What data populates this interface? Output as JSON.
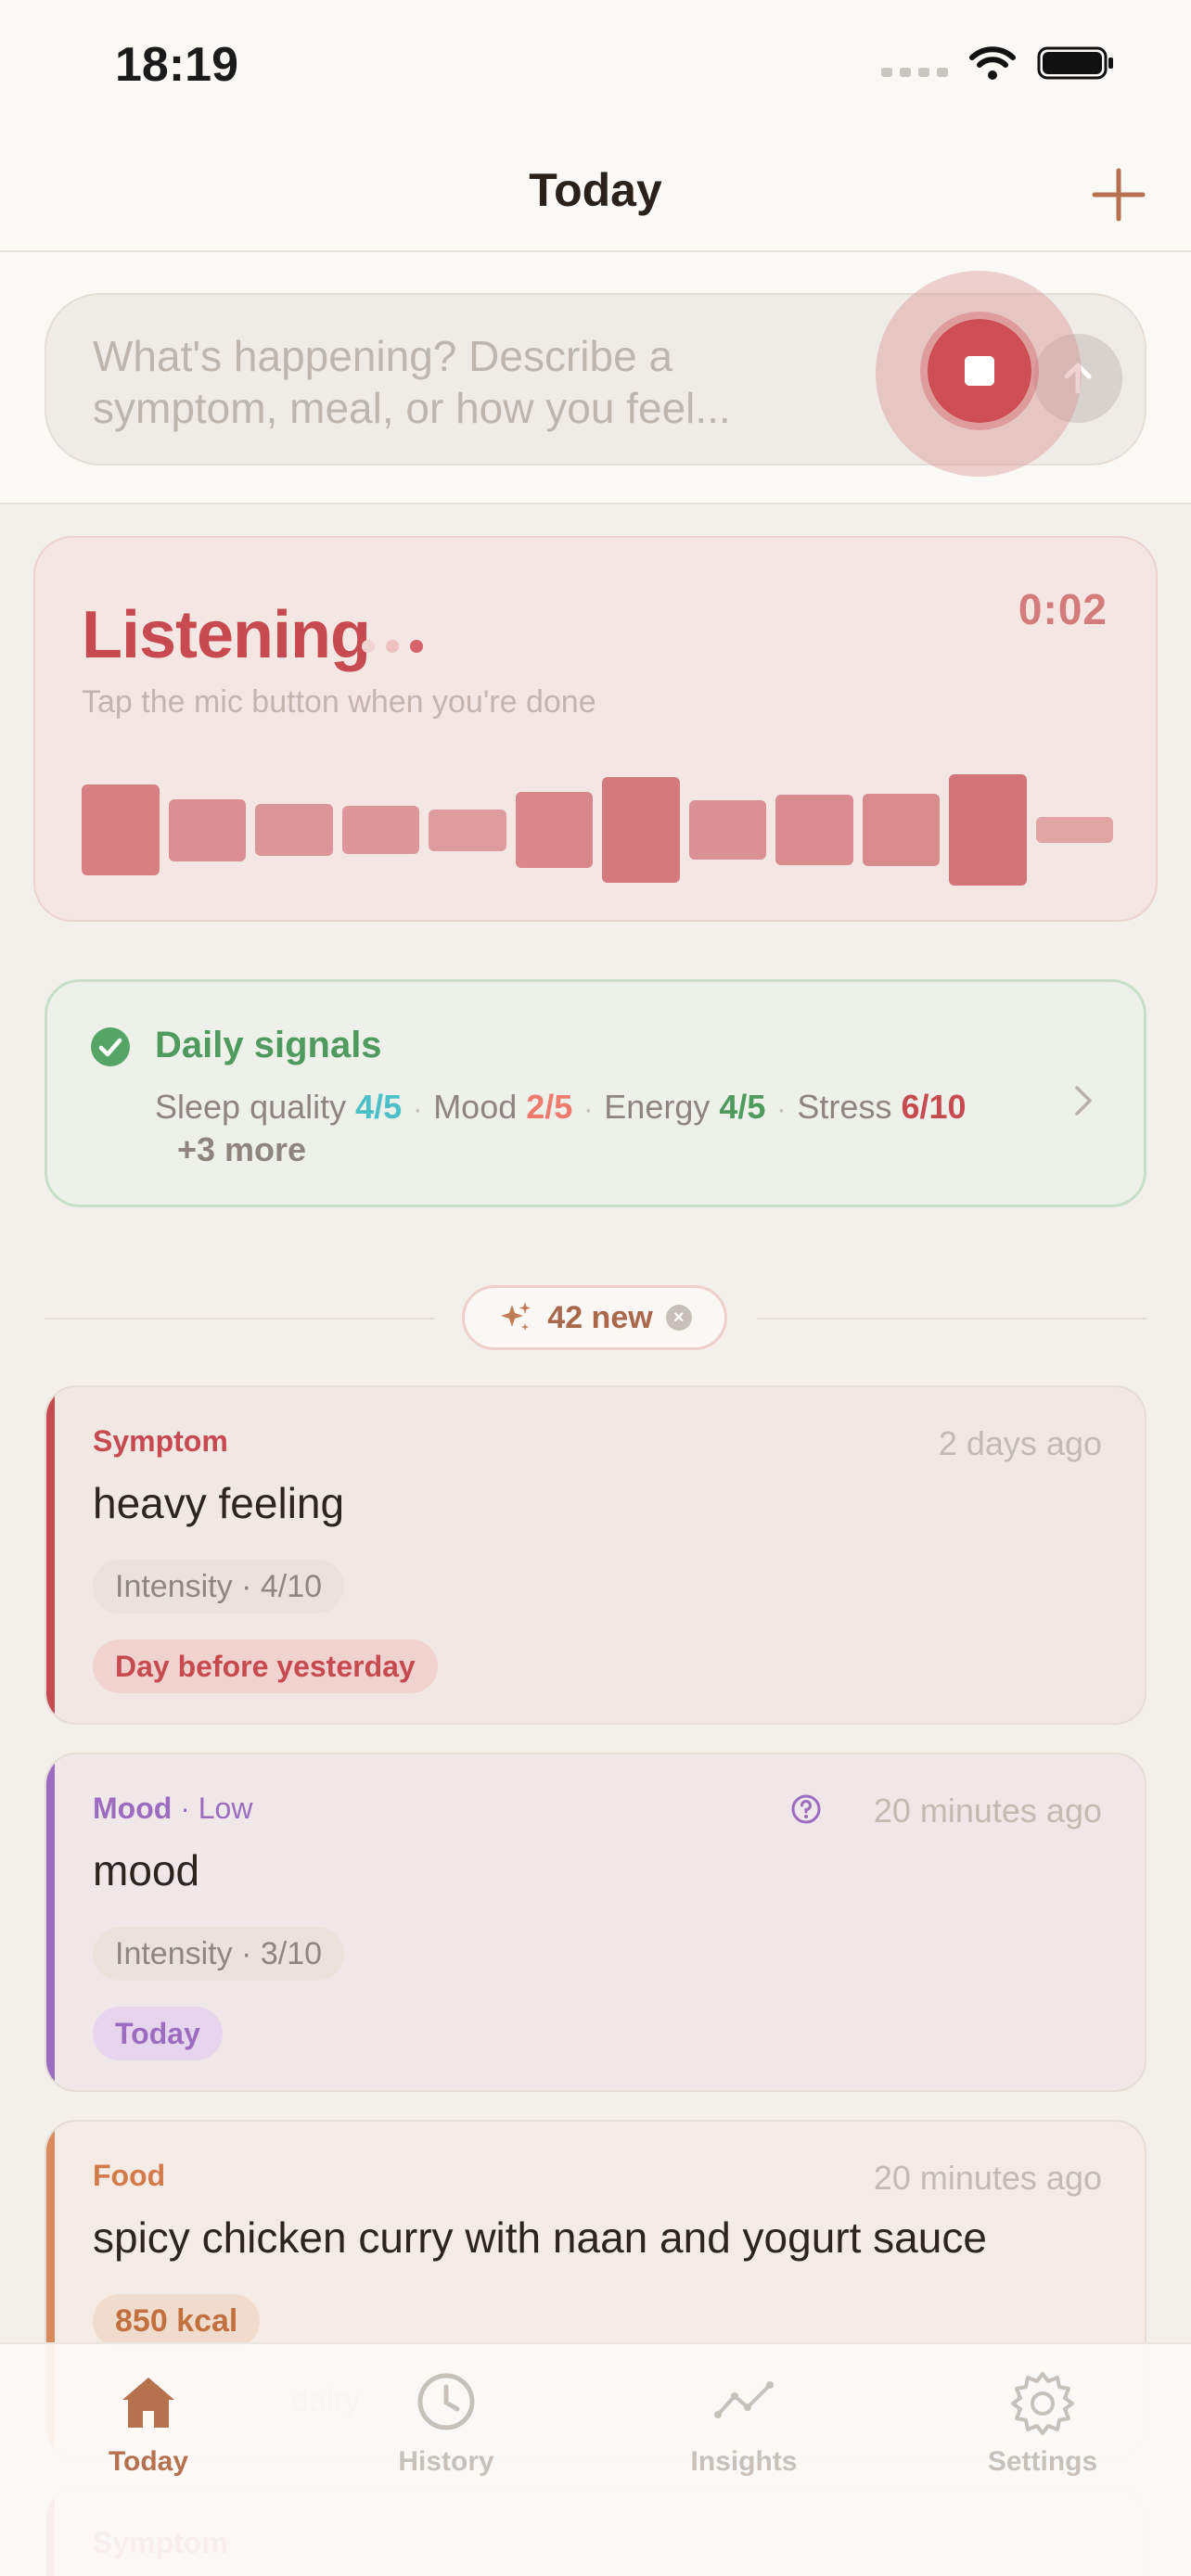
{
  "status_bar": {
    "time": "18:19"
  },
  "header": {
    "title": "Today"
  },
  "composer": {
    "placeholder": "What's happening? Describe a symptom, meal, or how you feel..."
  },
  "listening": {
    "title": "Listening",
    "timer": "0:02",
    "hint": "Tap the mic button when you're done",
    "levels": [
      0.78,
      0.5,
      0.4,
      0.36,
      0.3,
      0.64,
      0.92,
      0.48,
      0.58,
      0.6,
      0.98,
      0.14
    ]
  },
  "daily_signals": {
    "title": "Daily signals",
    "items": [
      {
        "label": "Sleep quality",
        "value": "4/5",
        "color": "#4bc0c8"
      },
      {
        "label": "Mood",
        "value": "2/5",
        "color": "#ef7a6e"
      },
      {
        "label": "Energy",
        "value": "4/5",
        "color": "#4f9a5e"
      },
      {
        "label": "Stress",
        "value": "6/10",
        "color": "#c74a50"
      }
    ],
    "more": "+3 more"
  },
  "new_badge": {
    "label": "42 new"
  },
  "entries": [
    {
      "type": "Symptom",
      "subtype": "",
      "time": "2 days ago",
      "title": "heavy feeling",
      "intensity": "Intensity · 4/10",
      "day_tag": "Day before yesterday",
      "accent": "#c74a50"
    },
    {
      "type": "Mood",
      "subtype": " · Low",
      "time": "20 minutes ago",
      "title": "mood",
      "intensity": "Intensity · 3/10",
      "day_tag": "Today",
      "accent": "#9b6cc0"
    },
    {
      "type": "Food",
      "subtype": "",
      "time": "20 minutes ago",
      "title": "spicy chicken curry with naan and yogurt sauce",
      "calories": "850 kcal",
      "tags_partial": [
        "dairy"
      ],
      "accent": "#d98a5c"
    },
    {
      "type": "Symptom",
      "accent": "#c74a50"
    }
  ],
  "tabs": [
    {
      "label": "Today",
      "icon": "home-icon",
      "active": true
    },
    {
      "label": "History",
      "icon": "clock-icon",
      "active": false
    },
    {
      "label": "Insights",
      "icon": "chart-line-icon",
      "active": false
    },
    {
      "label": "Settings",
      "icon": "gear-icon",
      "active": false
    }
  ],
  "colors": {
    "accent_primary": "#b6714e",
    "recording_red": "#cd4e55",
    "signals_green": "#4f9a5e"
  }
}
